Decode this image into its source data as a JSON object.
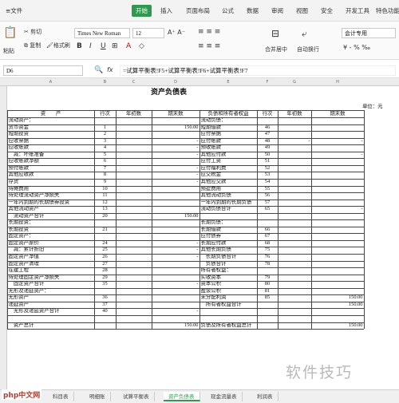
{
  "menu": {
    "file": "文件",
    "items": [
      "开始",
      "插入",
      "页面布局",
      "公式",
      "数据",
      "审阅",
      "视图",
      "安全",
      "开发工具",
      "特色功能"
    ],
    "active": "开始"
  },
  "ribbon": {
    "cut": "剪切",
    "copy": "复制",
    "format_painter": "格式刷",
    "paste": "粘贴",
    "font_name": "Times New Roman",
    "font_size": "12",
    "merge_center": "合并居中",
    "wrap": "自动换行",
    "number_format": "会计专用"
  },
  "formula_bar": {
    "cell_ref": "D6",
    "fx": "fx",
    "formula": "=试算平衡表!F5+试算平衡表!F6+试算平衡表!F7"
  },
  "columns": [
    "A",
    "B",
    "C",
    "D",
    "E",
    "F",
    "G",
    "H"
  ],
  "sheet": {
    "title": "资产负债表",
    "unit": "单位：元",
    "headers_left": [
      "资　　产",
      "行次",
      "年初数",
      "期末数"
    ],
    "headers_right": [
      "负债和所有者权益",
      "行次",
      "年初数",
      "期末数"
    ],
    "rows": [
      {
        "a": "流动资产：",
        "b": "",
        "c": "",
        "d": "",
        "e": "流动负债：",
        "f": "",
        "g": "",
        "h": ""
      },
      {
        "a": "货币资金",
        "b": "1",
        "c": "",
        "d": "150.00",
        "e": "短期借款",
        "f": "46",
        "g": "",
        "h": ""
      },
      {
        "a": "短期投资",
        "b": "2",
        "c": "",
        "d": "",
        "e": "应付票据",
        "f": "47",
        "g": "",
        "h": ""
      },
      {
        "a": "应收票据",
        "b": "3",
        "c": "",
        "d": "-",
        "e": "应付账款",
        "f": "48",
        "g": "-",
        "h": "-"
      },
      {
        "a": "应收账款",
        "b": "4",
        "c": "",
        "d": "-",
        "e": "预收账款",
        "f": "49",
        "g": "",
        "h": ""
      },
      {
        "a": "　减：坏账准备",
        "b": "5",
        "c": "",
        "d": "-",
        "e": "其他应付款",
        "f": "50",
        "g": "",
        "h": "-"
      },
      {
        "a": "应收账款净额",
        "b": "6",
        "c": "",
        "d": "",
        "e": "应付工资",
        "f": "51",
        "g": "",
        "h": ""
      },
      {
        "a": "预付账款",
        "b": "7",
        "c": "",
        "d": "-",
        "e": "应付福利费",
        "f": "52",
        "g": "",
        "h": ""
      },
      {
        "a": "其他应收款",
        "b": "8",
        "c": "",
        "d": "-",
        "e": "应交税金",
        "f": "53",
        "g": "",
        "h": ""
      },
      {
        "a": "存货",
        "b": "9",
        "c": "",
        "d": "-",
        "e": "其他应交款",
        "f": "54",
        "g": "",
        "h": ""
      },
      {
        "a": "待摊费用",
        "b": "10",
        "c": "",
        "d": "",
        "e": "预提费用",
        "f": "55",
        "g": "",
        "h": ""
      },
      {
        "a": "待处理流动资产净损失",
        "b": "11",
        "c": "",
        "d": "",
        "e": "其他流动负债",
        "f": "56",
        "g": "",
        "h": ""
      },
      {
        "a": "一年内到期的长期债券投资",
        "b": "12",
        "c": "",
        "d": "",
        "e": "一年内到期的长期负债",
        "f": "57",
        "g": "",
        "h": ""
      },
      {
        "a": "其他流动资产",
        "b": "13",
        "c": "",
        "d": "",
        "e": "流动负债合计",
        "f": "65",
        "g": "",
        "h": "-"
      },
      {
        "a": "　流动资产合计",
        "b": "20",
        "c": "",
        "d": "150.00",
        "e": "",
        "f": "",
        "g": "",
        "h": ""
      },
      {
        "a": "长期投资：",
        "b": "",
        "c": "",
        "d": "",
        "e": "长期负债：",
        "f": "",
        "g": "",
        "h": ""
      },
      {
        "a": "长期投资",
        "b": "21",
        "c": "",
        "d": "",
        "e": "长期借款",
        "f": "66",
        "g": "",
        "h": ""
      },
      {
        "a": "固定资产：",
        "b": "",
        "c": "",
        "d": "",
        "e": "应付债券",
        "f": "67",
        "g": "",
        "h": ""
      },
      {
        "a": "固定资产原价",
        "b": "24",
        "c": "",
        "d": "-",
        "e": "长期应付款",
        "f": "68",
        "g": "",
        "h": ""
      },
      {
        "a": "　减：累计折旧",
        "b": "25",
        "c": "",
        "d": "-",
        "e": "其他长期负债",
        "f": "75",
        "g": "",
        "h": ""
      },
      {
        "a": "固定资产净值",
        "b": "26",
        "c": "",
        "d": "-",
        "e": "　长期负债合计",
        "f": "76",
        "g": "",
        "h": ""
      },
      {
        "a": "固定资产清理",
        "b": "27",
        "c": "",
        "d": "",
        "e": "　负债合计",
        "f": "78",
        "g": "",
        "h": ""
      },
      {
        "a": "在建工程",
        "b": "28",
        "c": "",
        "d": "",
        "e": "所有者权益：",
        "f": "",
        "g": "",
        "h": ""
      },
      {
        "a": "待处理固定资产净损失",
        "b": "29",
        "c": "",
        "d": "",
        "e": "实收资本",
        "f": "79",
        "g": "",
        "h": ""
      },
      {
        "a": "　固定资产合计",
        "b": "35",
        "c": "",
        "d": "-",
        "e": "资本公积",
        "f": "80",
        "g": "",
        "h": ""
      },
      {
        "a": "无形及递延资产：",
        "b": "",
        "c": "",
        "d": "",
        "e": "盈余公积",
        "f": "81",
        "g": "",
        "h": ""
      },
      {
        "a": "无形资产",
        "b": "36",
        "c": "",
        "d": "",
        "e": "未分配利润",
        "f": "85",
        "g": "",
        "h": "150.00"
      },
      {
        "a": "递延资产",
        "b": "37",
        "c": "",
        "d": "",
        "e": "　所有者权益合计",
        "f": "",
        "g": "",
        "h": "150.00"
      },
      {
        "a": "　无形及递延资产合计",
        "b": "40",
        "c": "",
        "d": "-",
        "e": "",
        "f": "",
        "g": "",
        "h": ""
      },
      {
        "a": "",
        "b": "",
        "c": "",
        "d": "",
        "e": "",
        "f": "",
        "g": "",
        "h": ""
      },
      {
        "a": "　资产总计",
        "b": "",
        "c": "",
        "d": "150.00",
        "e": "负债及所有者权益总计",
        "f": "",
        "g": "",
        "h": "150.00"
      }
    ]
  },
  "tabs": [
    "科目表",
    "明细账",
    "试算平衡表",
    "资产负债表",
    "现金流量表",
    "利润表"
  ],
  "active_tab": "资产负债表",
  "watermark": "软件技巧",
  "logo": "php中文网",
  "colors": {
    "accent": "#2e9a4e",
    "grid": "#444444",
    "header_bg": "#ececec"
  }
}
